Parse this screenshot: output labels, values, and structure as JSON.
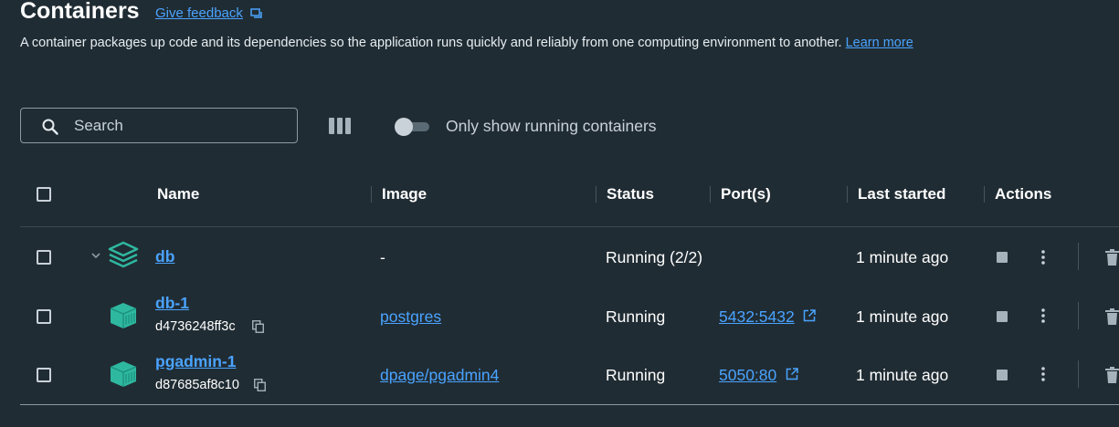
{
  "page": {
    "title": "Containers",
    "feedback_label": "Give feedback",
    "description": "A container packages up code and its dependencies so the application runs quickly and reliably from one computing environment to another.",
    "learn_more_label": "Learn more"
  },
  "toolbar": {
    "search_placeholder": "Search",
    "toggle_label": "Only show running containers",
    "toggle_on": false
  },
  "table": {
    "columns": [
      "Name",
      "Image",
      "Status",
      "Port(s)",
      "Last started",
      "Actions"
    ],
    "rows": [
      {
        "name": "db",
        "id": "",
        "image": "-",
        "status": "Running (2/2)",
        "ports": "",
        "last_started": "1 minute ago",
        "type": "stack"
      },
      {
        "name": "db-1",
        "id": "d4736248ff3c",
        "image": "postgres",
        "status": "Running",
        "ports": "5432:5432",
        "last_started": "1 minute ago",
        "type": "container"
      },
      {
        "name": "pgadmin-1",
        "id": "d87685af8c10",
        "image": "dpage/pgadmin4",
        "status": "Running",
        "ports": "5050:80",
        "last_started": "1 minute ago",
        "type": "container"
      }
    ]
  },
  "icons": {
    "search": "search-icon",
    "columns": "columns-icon",
    "stack": "stack-icon",
    "container": "container-icon",
    "copy": "copy-icon",
    "external": "external-link-icon",
    "stop": "stop-icon",
    "more": "kebab-menu-icon",
    "delete": "trash-icon"
  },
  "colors": {
    "background": "#202c33",
    "link": "#4aa3ff",
    "accent": "#2eb8a0"
  }
}
